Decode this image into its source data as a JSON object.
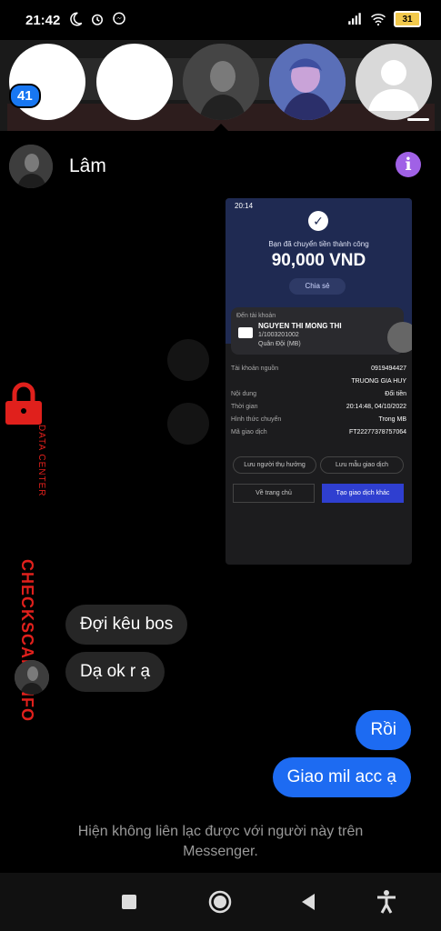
{
  "status": {
    "time": "21:42",
    "battery": "31"
  },
  "chat_heads": {
    "unread_badge": "41"
  },
  "header": {
    "name": "Lâm"
  },
  "screenshot": {
    "time": "20:14",
    "title": "Bạn đã chuyển tiền thành công",
    "amount": "90,000 VND",
    "share": "Chia sẻ",
    "to_account_label": "Đến tài khoản",
    "recipient": "NGUYEN THI MONG THI",
    "account_number": "1/1003201002",
    "bank": "Quân Đội (MB)",
    "rows": [
      {
        "label": "Tài khoản nguồn",
        "value": "0919494427"
      },
      {
        "label": "",
        "value": "TRUONG GIA HUY"
      },
      {
        "label": "Nội dung",
        "value": "Đổi tiền"
      },
      {
        "label": "Thời gian",
        "value": "20:14:48, 04/10/2022"
      },
      {
        "label": "Hình thức chuyển",
        "value": "Trong MB"
      },
      {
        "label": "Mã giao dịch",
        "value": "FT22277378757064"
      }
    ],
    "save_beneficiary": "Lưu người thụ hưởng",
    "save_template": "Lưu mẫu giao dịch",
    "home": "Về trang chủ",
    "new_transaction": "Tạo giao dịch khác"
  },
  "watermark": {
    "small": "DATA CENTER",
    "big": "CHECKSCAM.INFO"
  },
  "messages": {
    "received_1": "Đợi kêu bos",
    "received_2": "Dạ ok r ạ",
    "sent_1": "Rồi",
    "sent_2": "Giao mil acc ạ"
  },
  "footer": {
    "unavailable_line1": "Hiện không liên lạc được với người này trên",
    "unavailable_line2": "Messenger."
  },
  "colors": {
    "accent": "#1d6bf2",
    "info": "#a061e6",
    "watermark": "#e0201c"
  }
}
